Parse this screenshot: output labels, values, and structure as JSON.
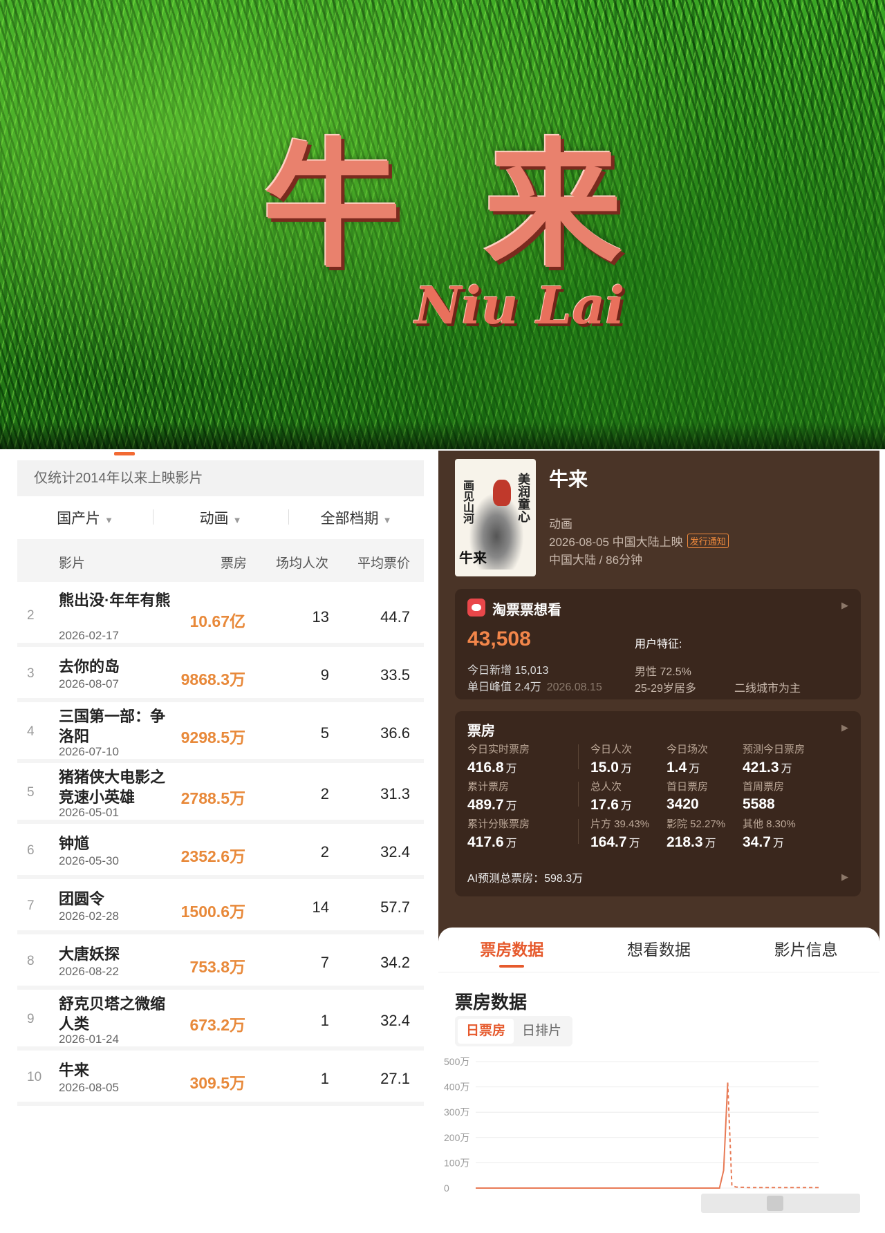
{
  "banner": {
    "title_cn": "牛来",
    "title_en": "Niu Lai"
  },
  "ranking": {
    "note": "仅统计2014年以来上映影片",
    "filters": [
      {
        "label": "国产片",
        "arrow": "▼"
      },
      {
        "label": "动画",
        "arrow": "▼"
      },
      {
        "label": "全部档期",
        "arrow": "▼"
      }
    ],
    "headers": {
      "film": "影片",
      "box_office": "票房",
      "avg_per_show": "场均人次",
      "avg_price": "平均票价"
    },
    "rows": [
      {
        "rank": "2",
        "name": "熊出没·年年有熊",
        "date": "2026-02-17",
        "box_office": "10.67亿",
        "avg": "13",
        "price": "44.7"
      },
      {
        "rank": "3",
        "name": "去你的岛",
        "date": "2026-08-07",
        "box_office": "9868.3万",
        "avg": "9",
        "price": "33.5"
      },
      {
        "rank": "4",
        "name": "三国第一部：争洛阳",
        "date": "2026-07-10",
        "box_office": "9298.5万",
        "avg": "5",
        "price": "36.6"
      },
      {
        "rank": "5",
        "name": "猪猪侠大电影之竞速小英雄",
        "date": "2026-05-01",
        "box_office": "2788.5万",
        "avg": "2",
        "price": "31.3"
      },
      {
        "rank": "6",
        "name": "钟馗",
        "date": "2026-05-30",
        "box_office": "2352.6万",
        "avg": "2",
        "price": "32.4"
      },
      {
        "rank": "7",
        "name": "团圆令",
        "date": "2026-02-28",
        "box_office": "1500.6万",
        "avg": "14",
        "price": "57.7"
      },
      {
        "rank": "8",
        "name": "大唐妖探",
        "date": "2026-08-22",
        "box_office": "753.8万",
        "avg": "7",
        "price": "34.2"
      },
      {
        "rank": "9",
        "name": "舒克贝塔之微缩人类",
        "date": "2026-01-24",
        "box_office": "673.2万",
        "avg": "1",
        "price": "32.4"
      },
      {
        "rank": "10",
        "name": "牛来",
        "date": "2026-08-05",
        "box_office": "309.5万",
        "avg": "1",
        "price": "27.1"
      }
    ]
  },
  "movie": {
    "title": "牛来",
    "genre": "动画",
    "release": "2026-08-05 中国大陆上映",
    "release_badge": "发行通知",
    "region_duration": "中国大陆 / 86分钟",
    "poster": {
      "text_a": "美润童心",
      "text_b": "画见山河",
      "title": "牛来"
    }
  },
  "want_card": {
    "heading": "淘票票想看",
    "count": "43,508",
    "today_new": "今日新增 15,013",
    "peak": "单日峰值 2.4万",
    "peak_date": "2026.08.15",
    "user_heading": "用户特征:",
    "gender": "男性 72.5%",
    "age": "25-29岁居多",
    "city": "二线城市为主"
  },
  "box_card": {
    "heading": "票房",
    "cells": [
      {
        "label": "今日实时票房",
        "value": "416.8",
        "unit": "万"
      },
      {
        "label": "今日人次",
        "value": "15.0",
        "unit": "万"
      },
      {
        "label": "今日场次",
        "value": "1.4",
        "unit": "万"
      },
      {
        "label": "预测今日票房",
        "value": "421.3",
        "unit": "万"
      },
      {
        "label": "累计票房",
        "value": "489.7",
        "unit": "万"
      },
      {
        "label": "总人次",
        "value": "17.6",
        "unit": "万"
      },
      {
        "label": "首日票房",
        "value": "3420",
        "unit": ""
      },
      {
        "label": "首周票房",
        "value": "5588",
        "unit": ""
      },
      {
        "label": "累计分账票房",
        "value": "417.6",
        "unit": "万"
      },
      {
        "label": "片方 39.43%",
        "value": "164.7",
        "unit": "万"
      },
      {
        "label": "影院 52.27%",
        "value": "218.3",
        "unit": "万"
      },
      {
        "label": "其他 8.30%",
        "value": "34.7",
        "unit": "万"
      }
    ],
    "ai_prediction": "AI预测总票房：598.3万"
  },
  "sheet": {
    "tabs": [
      "票房数据",
      "想看数据",
      "影片信息"
    ],
    "section_title": "票房数据",
    "segments": [
      "日票房",
      "日排片"
    ]
  },
  "colors": {
    "accent": "#e65a2d",
    "box_office_text": "#e8893a",
    "panel_bg": "#4a3427",
    "card_bg": "#3a271d"
  },
  "chart_data": {
    "type": "line",
    "ylabel": "",
    "yticks": [
      "500万",
      "400万",
      "300万",
      "200万",
      "100万",
      "0"
    ],
    "ylim": [
      0,
      500
    ],
    "grid": true,
    "series": [
      {
        "values": [
          0,
          0,
          0,
          0,
          0,
          0,
          0,
          0,
          0,
          0,
          0,
          0,
          0,
          0,
          0,
          0,
          0,
          0,
          0,
          0,
          0,
          0,
          0,
          0,
          0,
          0,
          0,
          0,
          0,
          0,
          0,
          0,
          0,
          0,
          0,
          0,
          0,
          0,
          0,
          0,
          0,
          0,
          0,
          0,
          0,
          0,
          0,
          0,
          0,
          0,
          0,
          0,
          0,
          0,
          0,
          0,
          0,
          0,
          0,
          0,
          70,
          417
        ],
        "style": "solid"
      },
      {
        "values_from_index": 61,
        "values": [
          417,
          10,
          4,
          3,
          3,
          2,
          2,
          2,
          2,
          2,
          2,
          2,
          2,
          2,
          2,
          2,
          2,
          2,
          2,
          2,
          2,
          2,
          2
        ],
        "style": "dashed"
      }
    ]
  }
}
